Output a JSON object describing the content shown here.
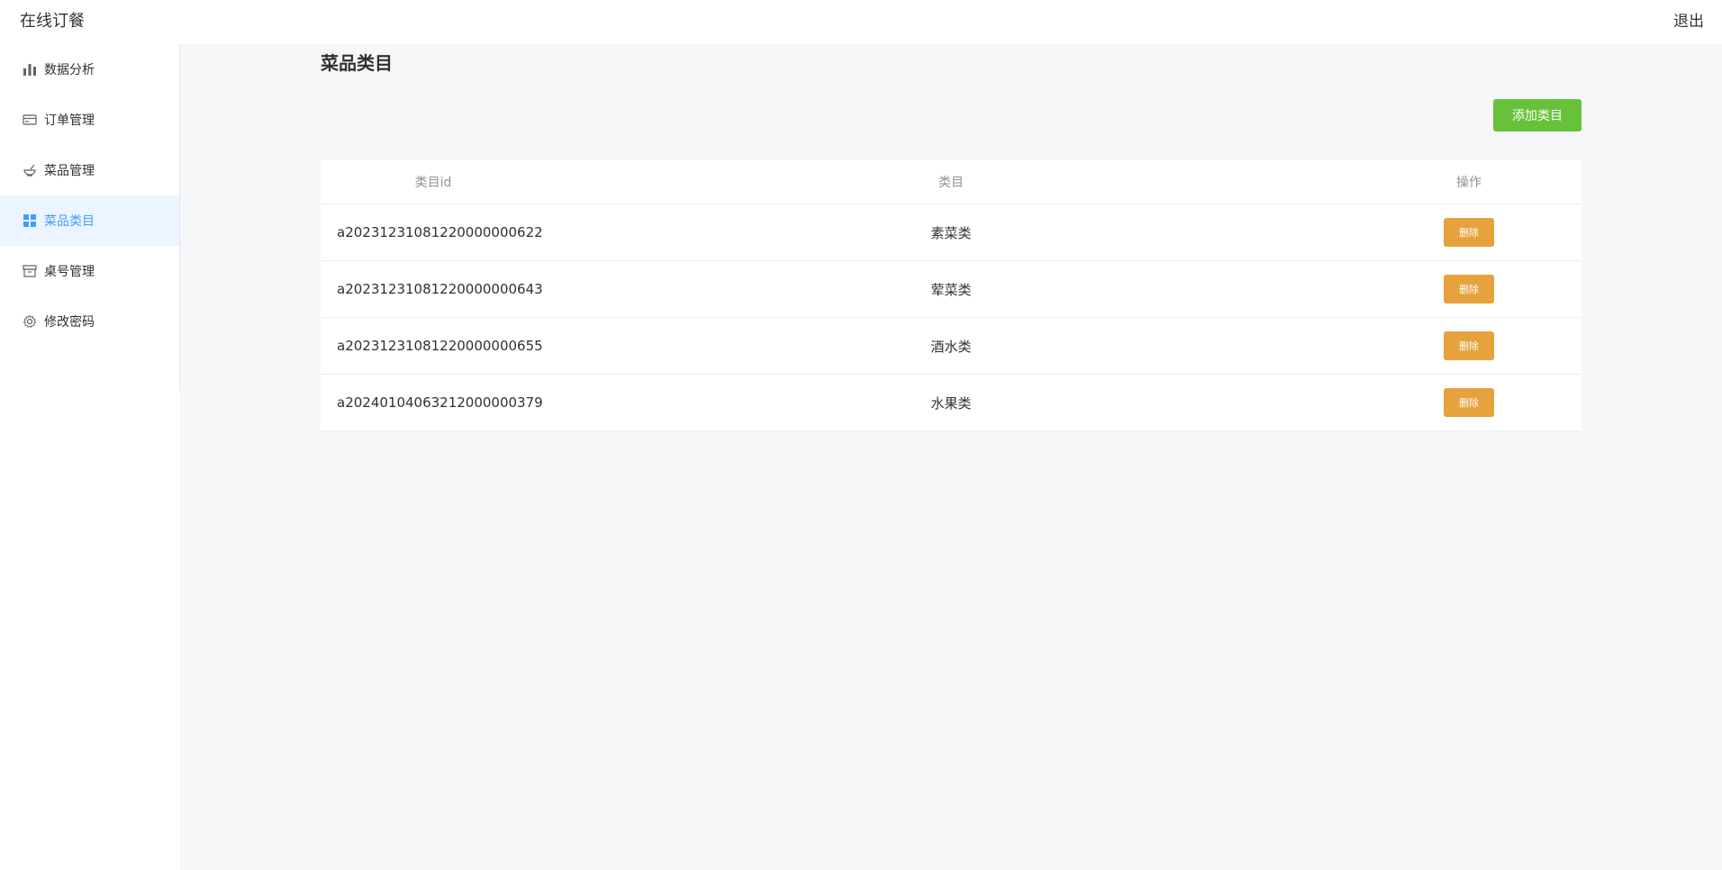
{
  "header": {
    "app_title": "在线订餐",
    "logout_label": "退出"
  },
  "sidebar": {
    "items": [
      {
        "label": "数据分析",
        "icon": "bar-chart-icon",
        "active": false
      },
      {
        "label": "订单管理",
        "icon": "credit-card-icon",
        "active": false
      },
      {
        "label": "菜品管理",
        "icon": "bowl-icon",
        "active": false
      },
      {
        "label": "菜品类目",
        "icon": "grid-icon",
        "active": true
      },
      {
        "label": "桌号管理",
        "icon": "box-icon",
        "active": false
      },
      {
        "label": "修改密码",
        "icon": "gear-icon",
        "active": false
      }
    ]
  },
  "main": {
    "page_title": "菜品类目",
    "add_button_label": "添加类目",
    "table": {
      "columns": [
        "类目id",
        "类目",
        "操作"
      ],
      "rows": [
        {
          "id": "a20231231081220000000622",
          "name": "素菜类",
          "action": "删除"
        },
        {
          "id": "a20231231081220000000643",
          "name": "荤菜类",
          "action": "删除"
        },
        {
          "id": "a20231231081220000000655",
          "name": "酒水类",
          "action": "删除"
        },
        {
          "id": "a20240104063212000000379",
          "name": "水果类",
          "action": "删除"
        }
      ]
    }
  },
  "colors": {
    "accent": "#409eff",
    "add_button": "#67c23a",
    "delete_button": "#e6a23c",
    "active_nav_bg": "#ecf5ff",
    "main_bg": "#f5f7f9"
  }
}
